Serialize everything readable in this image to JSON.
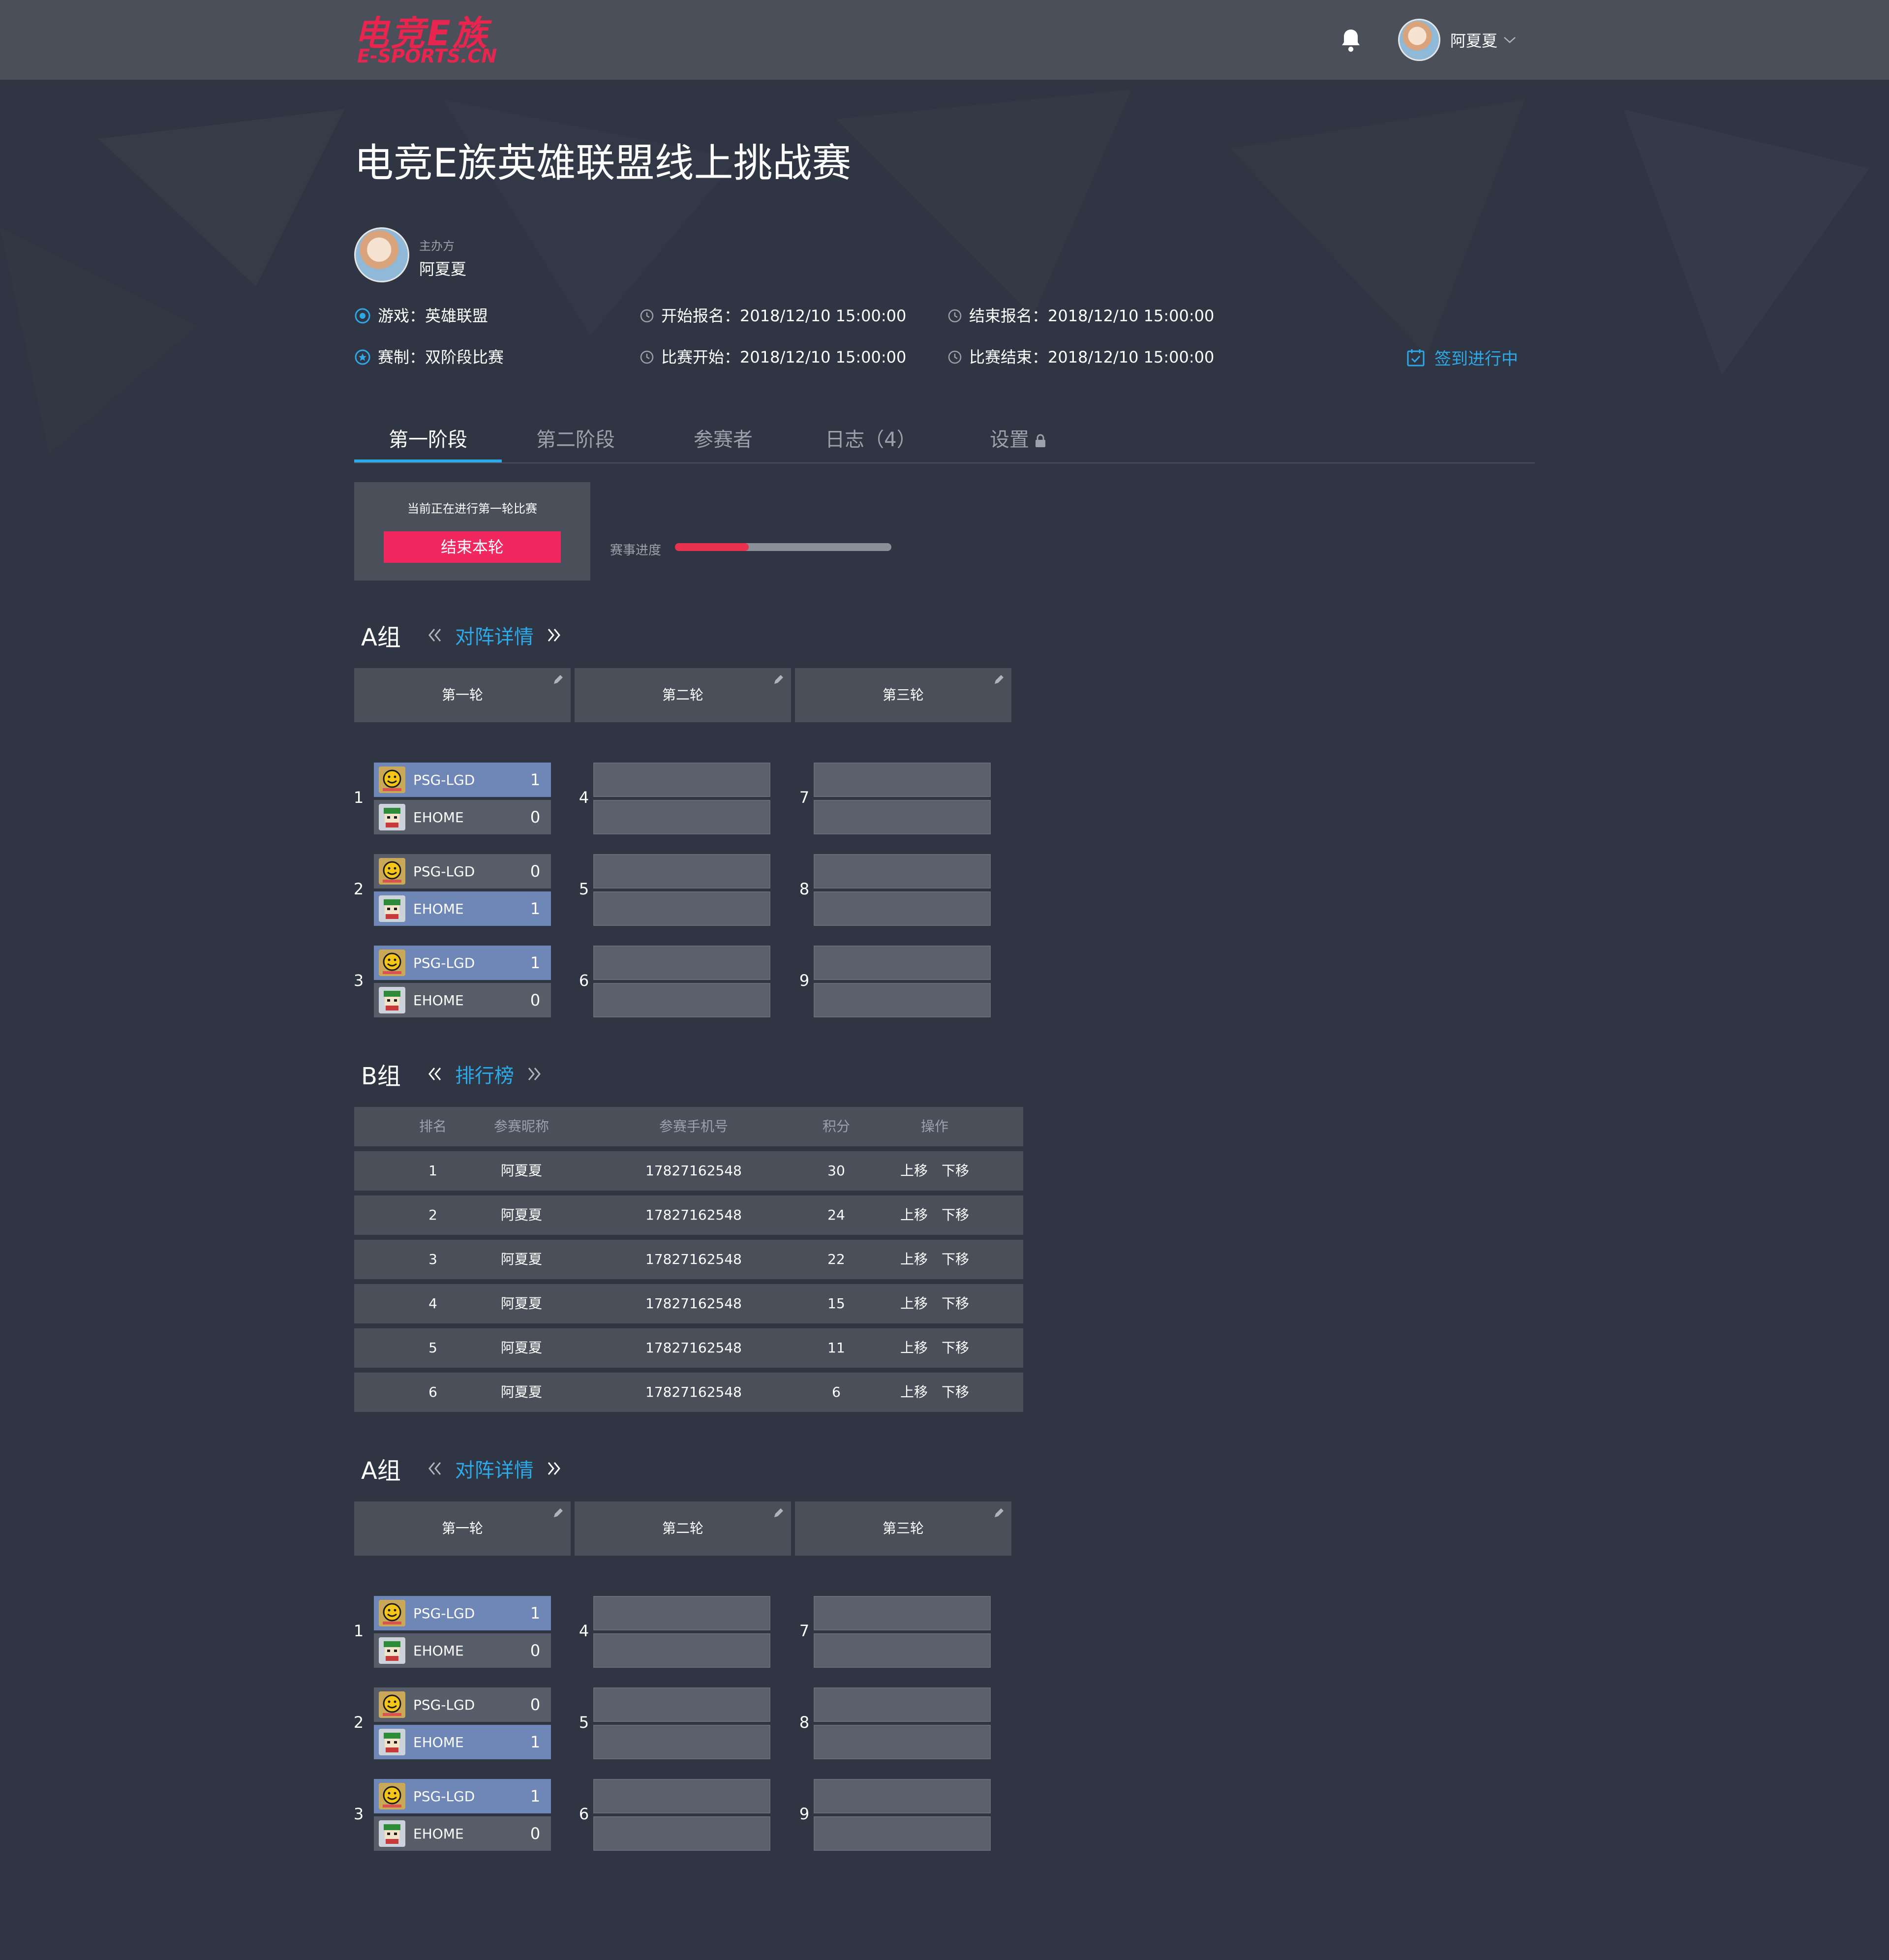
{
  "header": {
    "logo_cn": "电竞E族",
    "logo_en": "E-SPORTS.CN",
    "username": "阿夏夏"
  },
  "event": {
    "title": "电竞E族英雄联盟线上挑战赛",
    "organizer_label": "主办方",
    "organizer_name": "阿夏夏",
    "game": "游戏：英雄联盟",
    "format": "赛制：双阶段比赛",
    "reg_start": "开始报名：2018/12/10  15:00:00",
    "match_start": "比赛开始：2018/12/10  15:00:00",
    "reg_end": "结束报名：2018/12/10  15:00:00",
    "match_end": "比赛结束：2018/12/10  15:00:00",
    "signin_status": "签到进行中"
  },
  "tabs": [
    {
      "label": "第一阶段"
    },
    {
      "label": "第二阶段"
    },
    {
      "label": "参赛者"
    },
    {
      "label": "日志（4）"
    },
    {
      "label": "设置"
    }
  ],
  "round_status": {
    "text": "当前正在进行第一轮比赛",
    "end_button": "结束本轮",
    "progress_label": "赛事进度",
    "progress": 0.34
  },
  "colors": {
    "accent_blue": "#2fa8e8",
    "accent_red": "#f0285f",
    "win_slot": "#6e87b6"
  },
  "section_a1": {
    "title": "A组",
    "link": "对阵详情",
    "rounds": [
      "第一轮",
      "第二轮",
      "第三轮"
    ],
    "matches": [
      {
        "num": "1",
        "team1": "PSG-LGD",
        "score1": "1",
        "team2": "EHOME",
        "score2": "0"
      },
      {
        "num": "2",
        "team1": "PSG-LGD",
        "score1": "0",
        "team2": "EHOME",
        "score2": "1"
      },
      {
        "num": "3",
        "team1": "PSG-LGD",
        "score1": "1",
        "team2": "EHOME",
        "score2": "0"
      }
    ],
    "empty_numbers": [
      "4",
      "5",
      "6",
      "7",
      "8",
      "9"
    ]
  },
  "section_b": {
    "title": "B组",
    "link": "排行榜",
    "columns": [
      "排名",
      "参赛昵称",
      "参赛手机号",
      "积分",
      "操作"
    ],
    "rows": [
      {
        "rank": "1",
        "nickname": "阿夏夏",
        "phone": "17827162548",
        "score": "30",
        "up": "上移",
        "down": "下移"
      },
      {
        "rank": "2",
        "nickname": "阿夏夏",
        "phone": "17827162548",
        "score": "24",
        "up": "上移",
        "down": "下移"
      },
      {
        "rank": "3",
        "nickname": "阿夏夏",
        "phone": "17827162548",
        "score": "22",
        "up": "上移",
        "down": "下移"
      },
      {
        "rank": "4",
        "nickname": "阿夏夏",
        "phone": "17827162548",
        "score": "15",
        "up": "上移",
        "down": "下移"
      },
      {
        "rank": "5",
        "nickname": "阿夏夏",
        "phone": "17827162548",
        "score": "11",
        "up": "上移",
        "down": "下移"
      },
      {
        "rank": "6",
        "nickname": "阿夏夏",
        "phone": "17827162548",
        "score": "6",
        "up": "上移",
        "down": "下移"
      }
    ]
  },
  "section_a2": {
    "title": "A组",
    "link": "对阵详情",
    "rounds": [
      "第一轮",
      "第二轮",
      "第三轮"
    ],
    "matches": [
      {
        "num": "1",
        "team1": "PSG-LGD",
        "score1": "1",
        "team2": "EHOME",
        "score2": "0"
      },
      {
        "num": "2",
        "team1": "PSG-LGD",
        "score1": "0",
        "team2": "EHOME",
        "score2": "1"
      },
      {
        "num": "3",
        "team1": "PSG-LGD",
        "score1": "1",
        "team2": "EHOME",
        "score2": "0"
      }
    ],
    "empty_numbers": [
      "4",
      "5",
      "6",
      "7",
      "8",
      "9"
    ]
  }
}
